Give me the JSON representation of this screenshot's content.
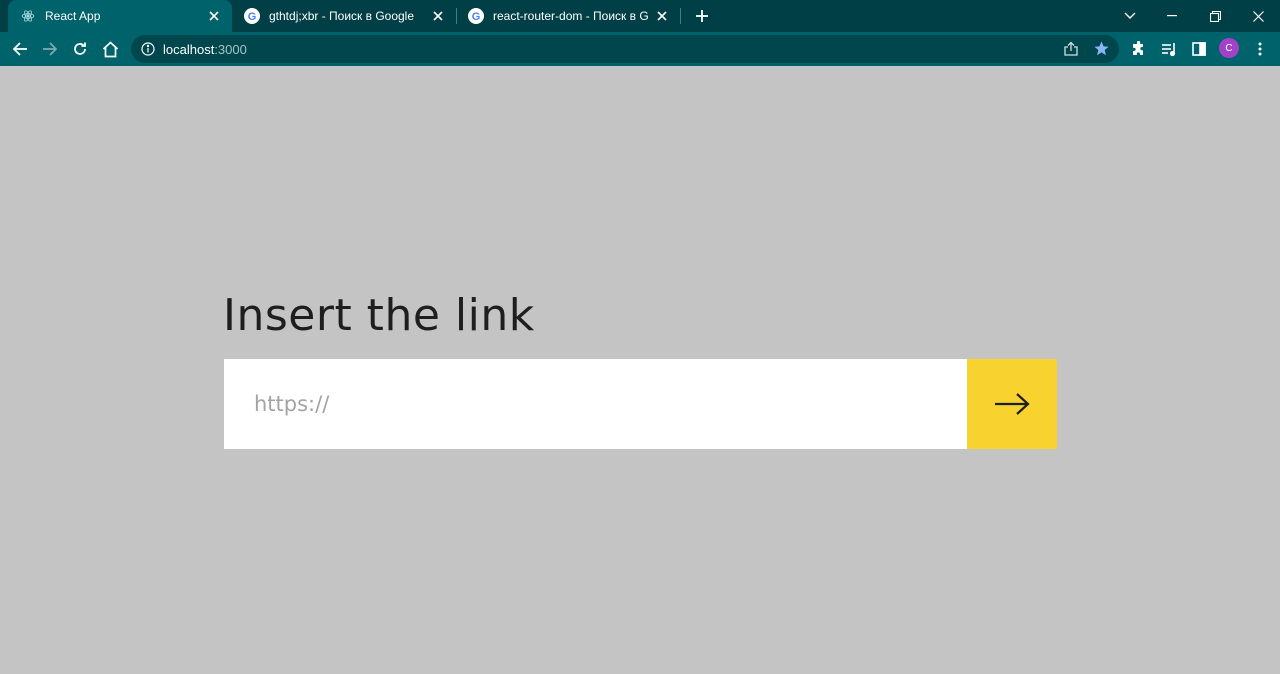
{
  "browser": {
    "tabs": [
      {
        "title": "React App",
        "icon": "react-icon",
        "active": true
      },
      {
        "title": "gthtdj;xbr - Поиск в Google",
        "icon": "google-icon",
        "active": false
      },
      {
        "title": "react-router-dom - Поиск в Google",
        "icon": "google-icon",
        "active": false
      }
    ],
    "address": {
      "host": "localhost",
      "port": ":3000"
    },
    "profile_initial": "C",
    "colors": {
      "tabstrip": "#003f45",
      "toolbar": "#00626a",
      "omnibox": "#00474d",
      "avatar": "#a142c9",
      "bookmark_star": "#8ab4f8"
    }
  },
  "page": {
    "heading": "Insert the link",
    "input_placeholder": "https://",
    "input_value": "",
    "submit_icon": "arrow-right-icon",
    "colors": {
      "background": "#c4c4c4",
      "submit_button": "#f8d22f",
      "text": "#1e1e1e"
    }
  }
}
